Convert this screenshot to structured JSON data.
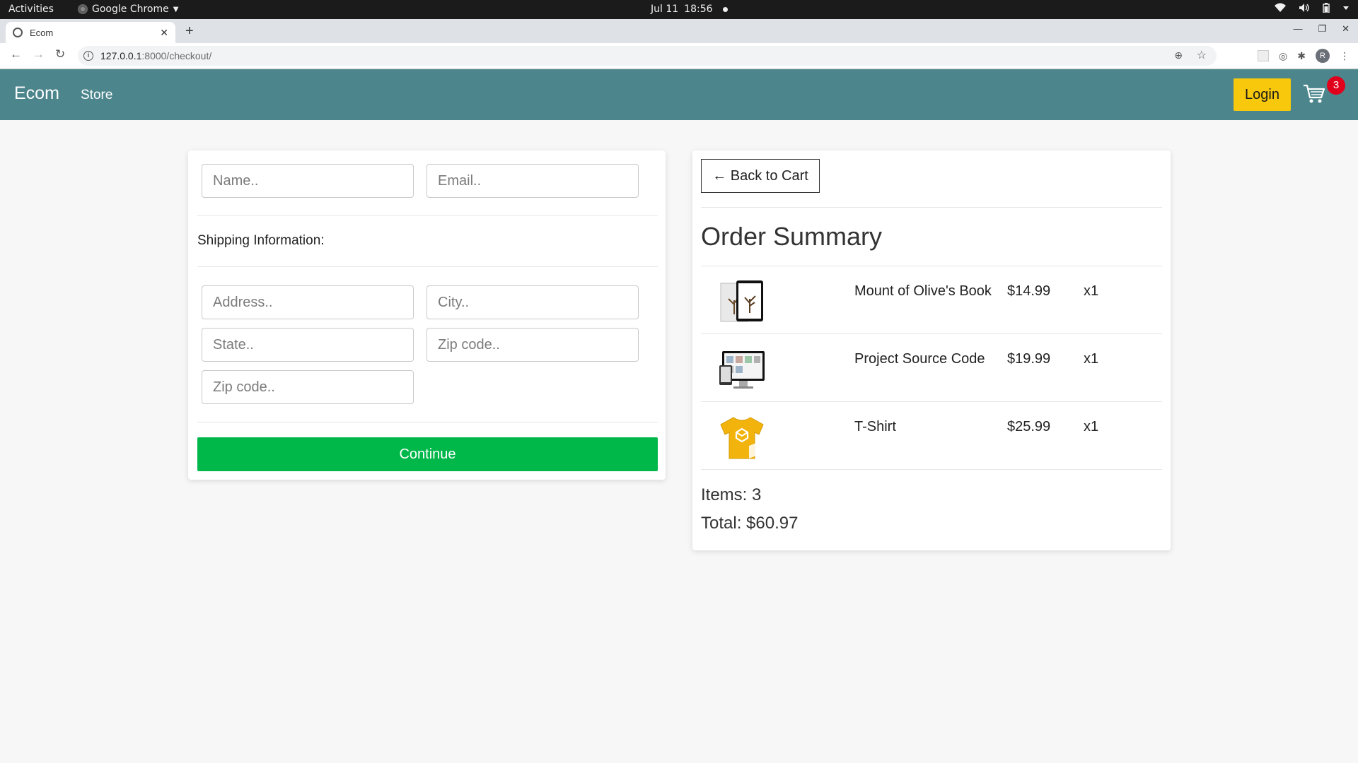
{
  "os_bar": {
    "activities": "Activities",
    "app_name": "Google Chrome",
    "date": "Jul 11",
    "time": "18:56"
  },
  "browser": {
    "tab_title": "Ecom",
    "url_host": "127.0.0.1",
    "url_path": ":8000/checkout/",
    "profile_initial": "R"
  },
  "nav": {
    "brand": "Ecom",
    "store_link": "Store",
    "login_label": "Login",
    "cart_count": "3"
  },
  "form": {
    "name_placeholder": "Name..",
    "email_placeholder": "Email..",
    "shipping_label": "Shipping Information:",
    "address_placeholder": "Address..",
    "city_placeholder": "City..",
    "state_placeholder": "State..",
    "zip_placeholder": "Zip code..",
    "zip2_placeholder": "Zip code..",
    "continue_label": "Continue"
  },
  "summary": {
    "back_label": "← Back to Cart",
    "title": "Order Summary",
    "items": [
      {
        "name": "Mount of Olive's Book",
        "price": "$14.99",
        "qty": "x1",
        "icon": "book-tablet-icon"
      },
      {
        "name": "Project Source Code",
        "price": "$19.99",
        "qty": "x1",
        "icon": "code-monitor-icon"
      },
      {
        "name": "T-Shirt",
        "price": "$25.99",
        "qty": "x1",
        "icon": "tshirt-icon"
      }
    ],
    "items_count_text": "Items: 3",
    "total_text": "Total: $60.97"
  },
  "colors": {
    "nav_bg": "#4c868c",
    "login_bg": "#f7c80c",
    "continue_bg": "#00b74a",
    "badge_bg": "#e0001b"
  }
}
